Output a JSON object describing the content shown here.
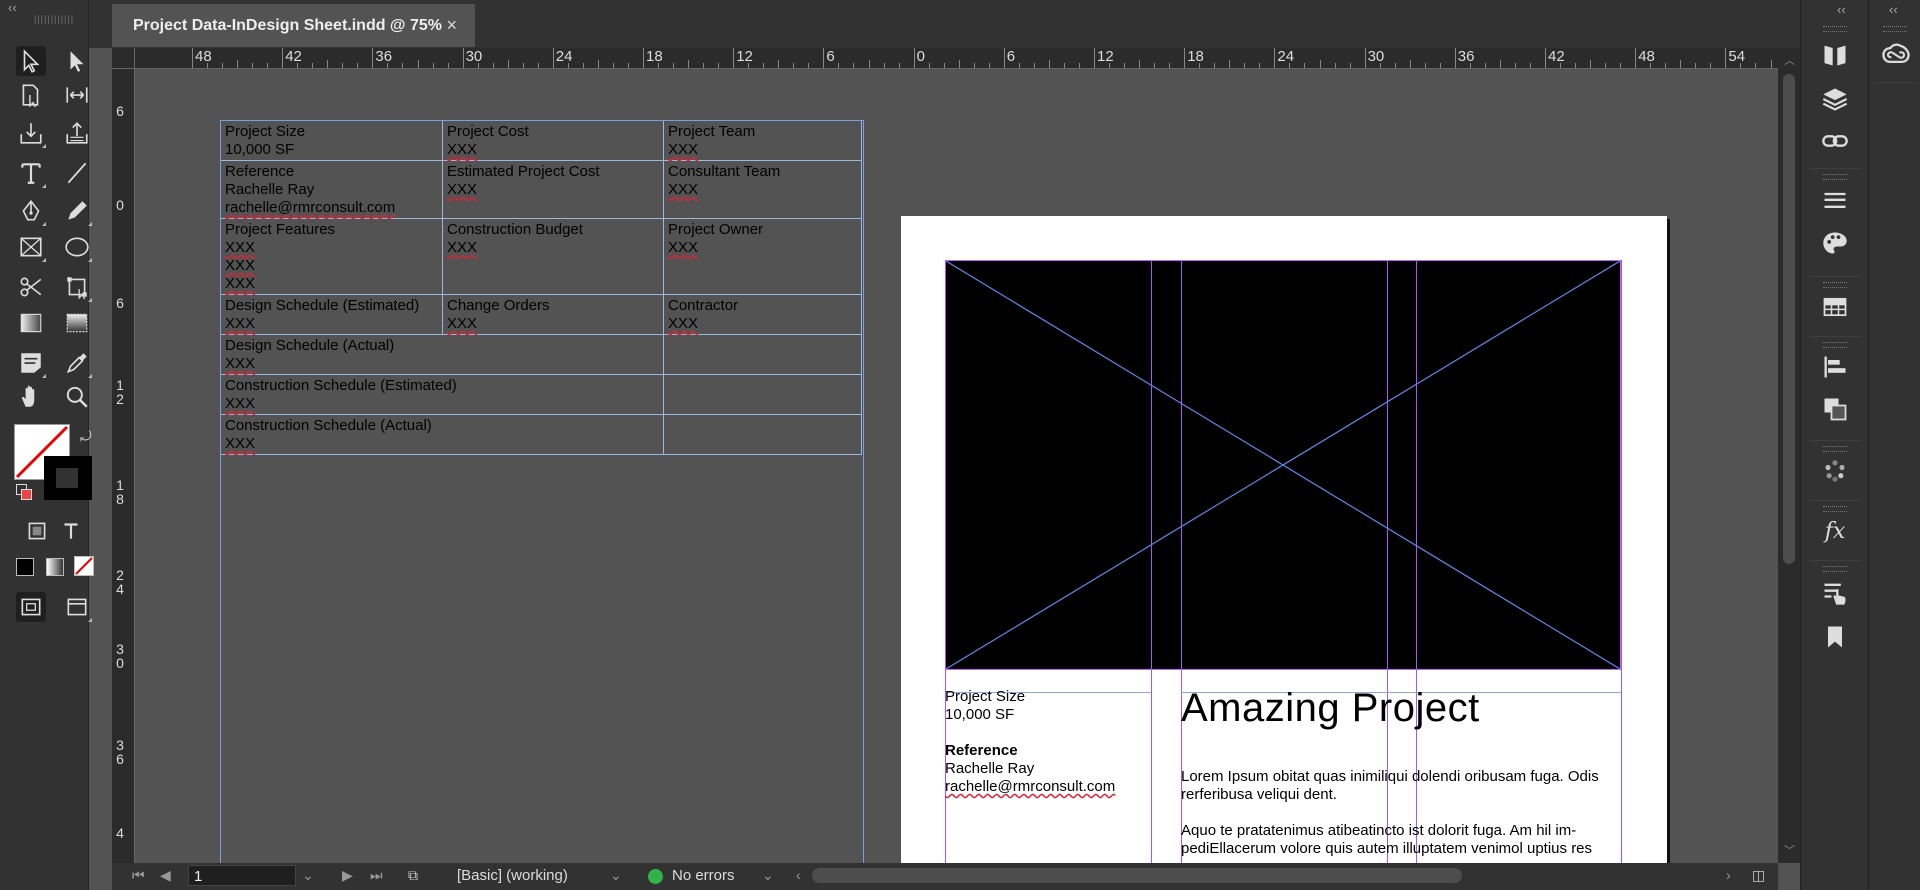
{
  "document_tab": {
    "title": "Project Data-InDesign Sheet.indd @ 75%",
    "close": "×"
  },
  "ruler": {
    "h_labels": [
      "48",
      "42",
      "36",
      "30",
      "24",
      "18",
      "12",
      "6",
      "0",
      "6",
      "12",
      "18",
      "24",
      "30",
      "36",
      "42",
      "48",
      "54"
    ],
    "v_labels": [
      "6",
      "0",
      "6",
      "1 2",
      "1 8",
      "2 4",
      "3 0",
      "3 6",
      "4"
    ]
  },
  "table": {
    "rows": [
      [
        {
          "label": "Project Size",
          "values": [
            "10,000 SF"
          ]
        },
        {
          "label": "Project Cost",
          "values": [
            "XXX"
          ]
        },
        {
          "label": "Project Team",
          "values": [
            "XXX"
          ]
        }
      ],
      [
        {
          "label": "Reference",
          "values": [
            "Rachelle Ray",
            "rachelle@rmrconsult.com"
          ]
        },
        {
          "label": "Estimated Project Cost",
          "values": [
            "XXX"
          ]
        },
        {
          "label": "Consultant Team",
          "values": [
            "XXX"
          ]
        }
      ],
      [
        {
          "label": "Project Features",
          "values": [
            "XXX",
            "XXX",
            "XXX"
          ]
        },
        {
          "label": "Construction Budget",
          "values": [
            "XXX"
          ]
        },
        {
          "label": "Project Owner",
          "values": [
            "XXX"
          ]
        }
      ],
      [
        {
          "label": "Design Schedule (Estimated)",
          "values": [
            "XXX"
          ]
        },
        {
          "label": "Change Orders",
          "values": [
            "XXX"
          ]
        },
        {
          "label": "Contractor",
          "values": [
            "XXX"
          ]
        }
      ]
    ],
    "wide_rows": [
      {
        "label": "Design Schedule (Actual)",
        "values": [
          "XXX"
        ]
      },
      {
        "label": "Construction Schedule (Estimated)",
        "values": [
          "XXX"
        ]
      },
      {
        "label": "Construction Schedule (Actual)",
        "values": [
          "XXX"
        ]
      }
    ]
  },
  "page": {
    "left_col": {
      "size_label": "Project Size",
      "size_value": "10,000 SF",
      "ref_label": "Reference",
      "ref_name": "Rachelle Ray",
      "ref_email": "rachelle@rmrconsult.com"
    },
    "title": "Amazing Project",
    "body1": "Lorem Ipsum obitat quas inimiliqui dolendi oribusam fuga. Odis rerferibusa veliqui dent.",
    "body2": "Aquo te pratatenimus atibeatincto ist dolorit fuga. Am hil im-pediEllacerum volore quis autem illuptatem venimol uptius res"
  },
  "status": {
    "page_number": "1",
    "style": "[Basic] (working)",
    "preflight": "No errors"
  },
  "colors": {
    "accent_guide": "#a855f7",
    "frame_edge": "#8aa8e0",
    "ok": "#2fb34a"
  }
}
